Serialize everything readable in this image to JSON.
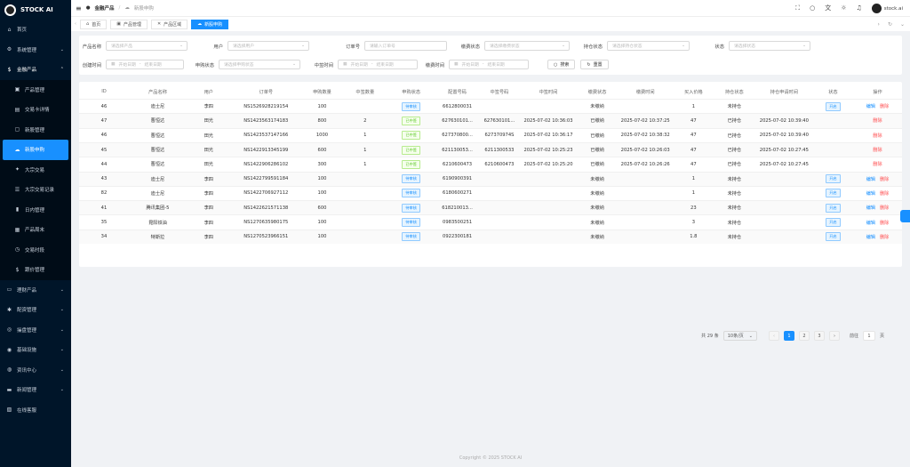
{
  "app": {
    "name": "STOCK AI",
    "user": "stock.ai"
  },
  "sidebar": {
    "items": [
      {
        "label": "首页",
        "icon": "home-icon",
        "glyph": "⌂",
        "type": "top"
      },
      {
        "label": "系统管理",
        "icon": "gear-icon",
        "glyph": "⚙",
        "type": "top",
        "chev": "⌄"
      },
      {
        "label": "金融产品",
        "icon": "money-icon",
        "glyph": "$",
        "type": "open",
        "chev": "⌃"
      },
      {
        "label": "产品管理",
        "icon": "box-icon",
        "glyph": "▣",
        "type": "sub"
      },
      {
        "label": "交易卡详情",
        "icon": "card-icon",
        "glyph": "▤",
        "type": "sub"
      },
      {
        "label": "新股管理",
        "icon": "doc-icon",
        "glyph": "▢",
        "type": "sub"
      },
      {
        "label": "新股申购",
        "icon": "cloud-icon",
        "glyph": "☁",
        "type": "active"
      },
      {
        "label": "大宗交易",
        "icon": "chart-icon",
        "glyph": "✦",
        "type": "sub"
      },
      {
        "label": "大宗交易记录",
        "icon": "list-icon",
        "glyph": "☰",
        "type": "sub"
      },
      {
        "label": "日内管理",
        "icon": "bookmark-icon",
        "glyph": "▮",
        "type": "sub"
      },
      {
        "label": "产品周末",
        "icon": "calendar-icon",
        "glyph": "▦",
        "type": "sub"
      },
      {
        "label": "交易时段",
        "icon": "clock-icon",
        "glyph": "◷",
        "type": "sub"
      },
      {
        "label": "跟价管理",
        "icon": "dollar-icon",
        "glyph": "$",
        "type": "sub"
      },
      {
        "label": "理财产品",
        "icon": "wallet-icon",
        "glyph": "▭",
        "type": "top",
        "chev": "⌄"
      },
      {
        "label": "配资管理",
        "icon": "settings-icon",
        "glyph": "✱",
        "type": "top",
        "chev": "⌄"
      },
      {
        "label": "操盘管理",
        "icon": "target-icon",
        "glyph": "◎",
        "type": "top",
        "chev": "⌄"
      },
      {
        "label": "基础设施",
        "icon": "server-icon",
        "glyph": "◉",
        "type": "top",
        "chev": "⌄"
      },
      {
        "label": "资讯中心",
        "icon": "globe-icon",
        "glyph": "◍",
        "type": "top",
        "chev": "⌄"
      },
      {
        "label": "新闻管理",
        "icon": "news-icon",
        "glyph": "▬",
        "type": "top",
        "chev": "⌄"
      },
      {
        "label": "在线客服",
        "icon": "chat-icon",
        "glyph": "▧",
        "type": "top"
      }
    ]
  },
  "breadcrumb": {
    "root": "金融产品",
    "current": "新股申购"
  },
  "tabs": [
    {
      "label": "首页",
      "glyph": "⌂",
      "active": false
    },
    {
      "label": "产品管理",
      "glyph": "▣",
      "active": false
    },
    {
      "label": "产品区域",
      "glyph": "✕",
      "active": false
    },
    {
      "label": "新股申购",
      "glyph": "☁",
      "active": true
    }
  ],
  "filters": {
    "product_name": {
      "label": "产品名称",
      "placeholder": "请选择产品"
    },
    "user": {
      "label": "用户",
      "placeholder": "请选择用户"
    },
    "order_no": {
      "label": "订单号",
      "placeholder": "请输入订单号"
    },
    "pay_status": {
      "label": "缴费状态",
      "placeholder": "请选择缴费状态"
    },
    "hold_status": {
      "label": "持仓状态",
      "placeholder": "请选择持仓状态"
    },
    "status": {
      "label": "状态",
      "placeholder": "请选择状态"
    },
    "create_time": {
      "label": "创建时间",
      "start": "开始日期",
      "sep": "-",
      "end": "结束日期"
    },
    "apply_status": {
      "label": "申购状态",
      "placeholder": "请选择申购状态"
    },
    "win_time": {
      "label": "中签时间",
      "start": "开始日期",
      "sep": "-",
      "end": "结束日期"
    },
    "pay_time": {
      "label": "缴费时间",
      "start": "开始日期",
      "sep": "-",
      "end": "结束日期"
    },
    "search_btn": "搜索",
    "reset_btn": "重置"
  },
  "table": {
    "columns": [
      "ID",
      "产品名称",
      "用户",
      "订单号",
      "申购数量",
      "中签数量",
      "申购状态",
      "配置号码",
      "中签号码",
      "中签时间",
      "缴费状态",
      "缴费时间",
      "买入价格",
      "持仓状态",
      "持仓申请时间",
      "状态",
      "操作"
    ],
    "rows": [
      {
        "id": "46",
        "product": "迪士尼",
        "user": "李四",
        "order": "NS1526928219154",
        "qty": "100",
        "win": "",
        "apply": "待审核",
        "apply_c": "blue",
        "cfg": "6612800031",
        "wno": "",
        "wtime": "",
        "pay": "未缴纳",
        "ptime": "",
        "price": "1",
        "hold": "未持仓",
        "htime": "",
        "state": "开启",
        "ops": [
          "编辑",
          "删除"
        ]
      },
      {
        "id": "47",
        "product": "曹恒达",
        "user": "田光",
        "order": "NS1423563174183",
        "qty": "800",
        "win": "2",
        "apply": "已中签",
        "apply_c": "green",
        "cfg": "627630101...",
        "wno": "627630101...",
        "wtime": "2025-07-02 10:36:03",
        "pay": "已缴纳",
        "ptime": "2025-07-02 10:37:25",
        "price": "47",
        "hold": "已持仓",
        "htime": "2025-07-02 10:39:40",
        "state": "",
        "ops": [
          "删除"
        ]
      },
      {
        "id": "46",
        "product": "曹恒达",
        "user": "田光",
        "order": "NS1423537147166",
        "qty": "1000",
        "win": "1",
        "apply": "已中签",
        "apply_c": "green",
        "cfg": "627370800...",
        "wno": "627370974S",
        "wtime": "2025-07-02 10:36:17",
        "pay": "已缴纳",
        "ptime": "2025-07-02 10:38:32",
        "price": "47",
        "hold": "已持仓",
        "htime": "2025-07-02 10:39:40",
        "state": "",
        "ops": [
          "删除"
        ]
      },
      {
        "id": "45",
        "product": "曹恒达",
        "user": "田光",
        "order": "NS1422913345199",
        "qty": "600",
        "win": "1",
        "apply": "已中签",
        "apply_c": "green",
        "cfg": "621130053...",
        "wno": "6211300533",
        "wtime": "2025-07-02 10:25:23",
        "pay": "已缴纳",
        "ptime": "2025-07-02 10:26:03",
        "price": "47",
        "hold": "已持仓",
        "htime": "2025-07-02 10:27:45",
        "state": "",
        "ops": [
          "删除"
        ]
      },
      {
        "id": "44",
        "product": "曹恒达",
        "user": "田光",
        "order": "NS1422906286102",
        "qty": "300",
        "win": "1",
        "apply": "已中签",
        "apply_c": "green",
        "cfg": "6210600473",
        "wno": "6210600473",
        "wtime": "2025-07-02 10:25:20",
        "pay": "已缴纳",
        "ptime": "2025-07-02 10:26:26",
        "price": "47",
        "hold": "已持仓",
        "htime": "2025-07-02 10:27:45",
        "state": "",
        "ops": [
          "删除"
        ]
      },
      {
        "id": "43",
        "product": "迪士尼",
        "user": "李四",
        "order": "NS1422799591184",
        "qty": "100",
        "win": "",
        "apply": "待审核",
        "apply_c": "blue",
        "cfg": "6190900391",
        "wno": "",
        "wtime": "",
        "pay": "未缴纳",
        "ptime": "",
        "price": "1",
        "hold": "未持仓",
        "htime": "",
        "state": "开启",
        "ops": [
          "编辑",
          "删除"
        ]
      },
      {
        "id": "82",
        "product": "迪士尼",
        "user": "李四",
        "order": "NS1422706927112",
        "qty": "100",
        "win": "",
        "apply": "待审核",
        "apply_c": "blue",
        "cfg": "6180600271",
        "wno": "",
        "wtime": "",
        "pay": "未缴纳",
        "ptime": "",
        "price": "1",
        "hold": "未持仓",
        "htime": "",
        "state": "开启",
        "ops": [
          "编辑",
          "删除"
        ]
      },
      {
        "id": "41",
        "product": "腾讯集团-5",
        "user": "李四",
        "order": "NS1422621571138",
        "qty": "600",
        "win": "",
        "apply": "待审核",
        "apply_c": "blue",
        "cfg": "618210013...",
        "wno": "",
        "wtime": "",
        "pay": "未缴纳",
        "ptime": "",
        "price": "23",
        "hold": "未持仓",
        "htime": "",
        "state": "开启",
        "ops": [
          "编辑",
          "删除"
        ]
      },
      {
        "id": "35",
        "product": "昆阳铁油",
        "user": "李四",
        "order": "NS1270635980175",
        "qty": "100",
        "win": "",
        "apply": "待审核",
        "apply_c": "blue",
        "cfg": "0983500251",
        "wno": "",
        "wtime": "",
        "pay": "未缴纳",
        "ptime": "",
        "price": "3",
        "hold": "未持仓",
        "htime": "",
        "state": "开启",
        "ops": [
          "编辑",
          "删除"
        ]
      },
      {
        "id": "34",
        "product": "特斯拉",
        "user": "李四",
        "order": "NS1270523966151",
        "qty": "100",
        "win": "",
        "apply": "待审核",
        "apply_c": "blue",
        "cfg": "0922300181",
        "wno": "",
        "wtime": "",
        "pay": "未缴纳",
        "ptime": "",
        "price": "1.8",
        "hold": "未持仓",
        "htime": "",
        "state": "开启",
        "ops": [
          "编辑",
          "删除"
        ]
      }
    ]
  },
  "pagination": {
    "total": "共 29 条",
    "page_size": "10条/页",
    "pages": [
      "1",
      "2",
      "3"
    ],
    "current": "1",
    "goto_label": "前往",
    "goto_value": "1",
    "goto_suffix": "页",
    "prev": "‹",
    "next": "›"
  },
  "footer": "Copyright © 2025 STOCK AI",
  "colors": {
    "sidebar": "#001529",
    "accent": "#1890ff",
    "danger": "#ff4d4f"
  }
}
